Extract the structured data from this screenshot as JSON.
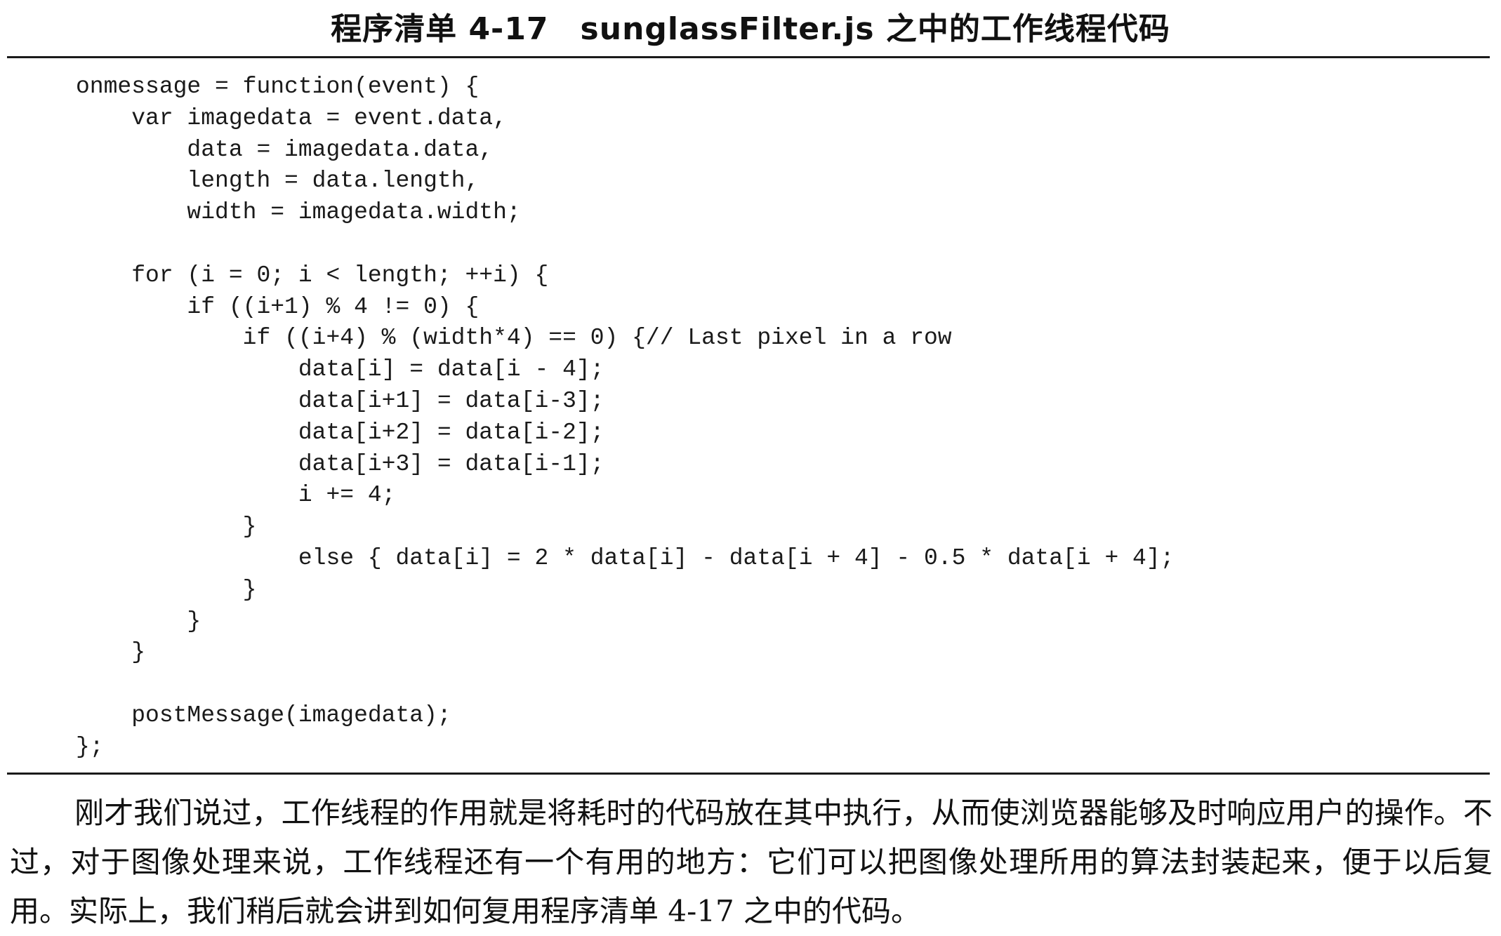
{
  "listing": {
    "title": "程序清单 4-17　sunglassFilter.js 之中的工作线程代码"
  },
  "code": {
    "lines": [
      "onmessage = function(event) {",
      "    var imagedata = event.data,",
      "        data = imagedata.data,",
      "        length = data.length,",
      "        width = imagedata.width;",
      "",
      "    for (i = 0; i < length; ++i) {",
      "        if ((i+1) % 4 != 0) {",
      "            if ((i+4) % (width*4) == 0) {// Last pixel in a row",
      "                data[i] = data[i - 4];",
      "                data[i+1] = data[i-3];",
      "                data[i+2] = data[i-2];",
      "                data[i+3] = data[i-1];",
      "                i += 4;",
      "            }",
      "                else { data[i] = 2 * data[i] - data[i + 4] - 0.5 * data[i + 4];",
      "            }",
      "        }",
      "    }",
      "",
      "    postMessage(imagedata);",
      "};"
    ]
  },
  "body": {
    "paragraph": "刚才我们说过，工作线程的作用就是将耗时的代码放在其中执行，从而使浏览器能够及时响应用户的操作。不过，对于图像处理来说，工作线程还有一个有用的地方：它们可以把图像处理所用的算法封装起来，便于以后复用。实际上，我们稍后就会讲到如何复用程序清单 4-17 之中的代码。"
  }
}
